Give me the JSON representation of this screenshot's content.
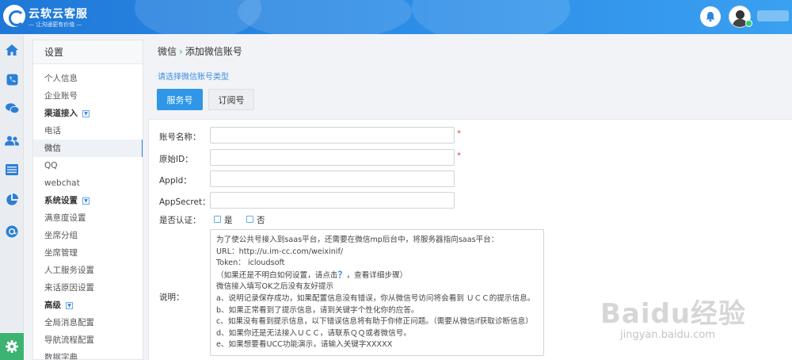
{
  "header": {
    "brand": "云软云客服",
    "slogan": "— 让沟通更有价值 —"
  },
  "iconbar": {
    "icons": [
      "home-icon",
      "phone-icon",
      "chat-icon",
      "contacts-icon",
      "list-icon",
      "pie-chart-icon",
      "at-sign-icon"
    ],
    "bottom_icon": "gear-icon"
  },
  "sidebar": {
    "title": "设置",
    "items": [
      {
        "label": "个人信息",
        "type": "item"
      },
      {
        "label": "企业账号",
        "type": "item"
      },
      {
        "label": "渠道接入",
        "type": "group"
      },
      {
        "label": "电话",
        "type": "item"
      },
      {
        "label": "微信",
        "type": "item",
        "active": true
      },
      {
        "label": "QQ",
        "type": "item"
      },
      {
        "label": "webchat",
        "type": "item"
      },
      {
        "label": "系统设置",
        "type": "group"
      },
      {
        "label": "满意度设置",
        "type": "item"
      },
      {
        "label": "坐席分组",
        "type": "item"
      },
      {
        "label": "坐席管理",
        "type": "item"
      },
      {
        "label": "人工服务设置",
        "type": "item"
      },
      {
        "label": "来话原因设置",
        "type": "item"
      },
      {
        "label": "高级",
        "type": "group"
      },
      {
        "label": "全局消息配置",
        "type": "item"
      },
      {
        "label": "导航流程配置",
        "type": "item"
      },
      {
        "label": "数据字典",
        "type": "item"
      }
    ]
  },
  "breadcrumb": {
    "parent": "微信",
    "separator": "›",
    "current": "添加微信账号"
  },
  "hint": "请选择微信账号类型",
  "account_types": {
    "service": "服务号",
    "subscription": "订阅号"
  },
  "form": {
    "account_name_label": "账号名称：",
    "original_id_label": "原始ID：",
    "appid_label": "AppId：",
    "appsecret_label": "AppSecret：",
    "verified_label": "是否认证：",
    "yes": "是",
    "no": "否",
    "required_mark": "*",
    "desc_label": "说明："
  },
  "description": {
    "line1": "为了使公共号接入到saas平台，还需要在微信mp后台中，将服务器指向saas平台：",
    "line2": "URL：http://u.im-cc.com/weixinif/",
    "line3": "Token： icloudsoft",
    "line4_pre": "（如果还是不明白如何设置，请点击",
    "line4_q": "？",
    "line4_post": "，查看详细步骤）",
    "line5": "微信接入填写OK之后没有友好提示",
    "line6": "a、说明记录保存成功，如果配置信息没有错误，你从微信号访问将会看到 ＵＣＣ的提示信息。",
    "line7": "b、如果正常看到了提示信息，请到关键字个性化你的应答。",
    "line8": "c、如果没有看到提示信息，以下错误信息将有助于你修正问题。（需要从微信if获取诊断信息）",
    "line9": "d、如果你还是无法接入ＵＣＣ，请联系ＱＱ或者微信号。",
    "line10": "e、如果想要看UCC功能演示，请输入关键字XXXXX"
  },
  "watermark": {
    "text": "Baidu经验",
    "url": "jingyan.baidu.com"
  }
}
